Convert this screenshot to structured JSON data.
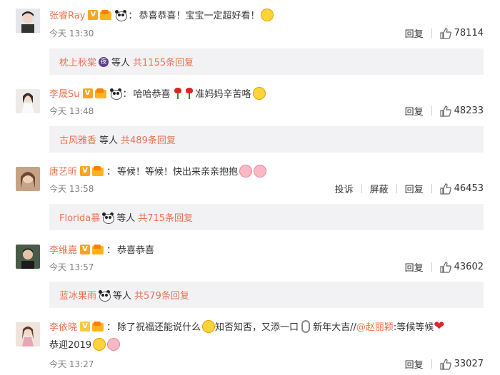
{
  "comments": [
    {
      "user": "张睿Ray",
      "text": "恭喜恭喜！宝宝一定超好看！",
      "time": "今天 13:30",
      "reply_label": "回复",
      "likes": "78114",
      "reply_preview": {
        "name": "枕上秋棠",
        "mid": "等人",
        "count": "共1155条回复"
      },
      "avatar_color": "#2b2b33"
    },
    {
      "user": "李晟Su",
      "text": "哈哈恭喜",
      "text2": "准妈妈辛苦咯",
      "time": "今天 13:48",
      "reply_label": "回复",
      "likes": "48233",
      "reply_preview": {
        "name": "古风雅香",
        "mid": "等人",
        "count": "共489条回复"
      },
      "avatar_color": "#d8d3cf"
    },
    {
      "user": "唐艺昕",
      "text": "等候！等候！快出来亲亲抱抱",
      "time": "今天 13:58",
      "report_label": "投诉",
      "block_label": "屏蔽",
      "reply_label": "回复",
      "likes": "46453",
      "reply_preview": {
        "name": "Florida慕",
        "mid": "等人",
        "count": "共715条回复"
      },
      "avatar_color": "#c9a487"
    },
    {
      "user": "李维嘉",
      "text": "恭喜恭喜",
      "time": "今天 13:57",
      "reply_label": "回复",
      "likes": "43602",
      "reply_preview": {
        "name": "蓝冰果雨",
        "mid": "等人",
        "count": "共579条回复"
      },
      "avatar_color": "#3c4a3e"
    },
    {
      "user": "李依晓",
      "text": "除了祝福还能说什么",
      "text_b": "知否知否，又添一口",
      "text_c": "新年大吉//",
      "mention": "@赵丽颖",
      "text_d": ":等候等候",
      "line2": "恭迎2019",
      "time": "今天 13:27",
      "reply_label": "回复",
      "likes": "33027",
      "avatar_color": "#e9d7cf"
    }
  ],
  "colors": {
    "accent": "#eb7350",
    "time": "#808080",
    "reply_bg": "#f2f2f5"
  },
  "icons": [
    "verified-badge-icon",
    "vip-icon",
    "panda-icon",
    "thumb-up-icon"
  ]
}
